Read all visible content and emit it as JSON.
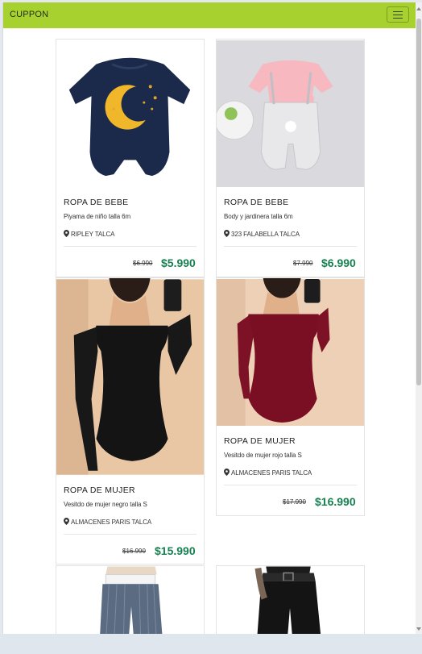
{
  "navbar": {
    "brand": "CUPPON",
    "menu_icon": "hamburger-icon",
    "color": "#a6d12f"
  },
  "products": [
    {
      "category": "ROPA DE BEBE",
      "description": "Piyama de niño talla 6m",
      "store": "RIPLEY TALCA",
      "old_price": "$6.990",
      "price": "$5.990"
    },
    {
      "category": "ROPA DE BEBE",
      "description": "Body y jardinera talla 6m",
      "store": "323 FALABELLA TALCA",
      "old_price": "$7.990",
      "price": "$6.990"
    },
    {
      "category": "ROPA DE MUJER",
      "description": "Vesitdo de mujer negro talla S",
      "store": "ALMACENES PARIS TALCA",
      "old_price": "$16.990",
      "price": "$15.990"
    },
    {
      "category": "ROPA DE MUJER",
      "description": "Vesitdo de mujer rojo talla S",
      "store": "ALMACENES PARIS TALCA",
      "old_price": "$17.990",
      "price": "$16.990"
    }
  ],
  "colors": {
    "price": "#168050",
    "border": "#e3e3e3"
  }
}
